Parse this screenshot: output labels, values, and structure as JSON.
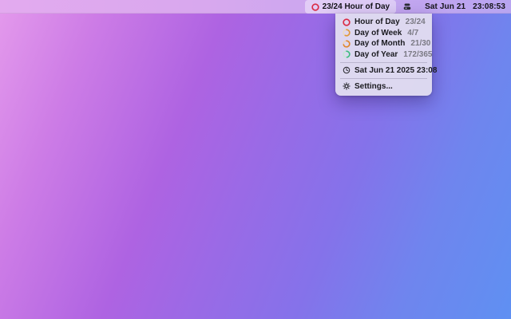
{
  "wallpaper": {
    "gradient_from": "#e49aec",
    "gradient_mid": "#9a6ae6",
    "gradient_to": "#5f90f2"
  },
  "menu_bar": {
    "active_item": {
      "label": "23/24 Hour of Day",
      "icon": "progress-ring-icon",
      "progress": 0.958,
      "color": "#d92b47",
      "track": "#eec9ce"
    },
    "extra_icon": "stacked-discs-icon",
    "clock_date": "Sat Jun 21",
    "clock_time": "23:08:53"
  },
  "dropdown": {
    "items": [
      {
        "label": "Hour of Day",
        "value": "23/24",
        "progress": 0.958,
        "color": "#d92b47",
        "track": "#eec9ce",
        "icon": "progress-ring-icon"
      },
      {
        "label": "Day of Week",
        "value": "4/7",
        "progress": 0.571,
        "color": "#e0983a",
        "track": "#ecdbc0",
        "icon": "progress-ring-icon"
      },
      {
        "label": "Day of Month",
        "value": "21/30",
        "progress": 0.7,
        "color": "#e0862f",
        "track": "#eed4ba",
        "icon": "progress-ring-icon"
      },
      {
        "label": "Day of Year",
        "value": "172/365",
        "progress": 0.471,
        "color": "#3cba80",
        "track": "#c8e5d6",
        "icon": "progress-ring-icon"
      }
    ],
    "datetime_row": {
      "label": "Sat Jun 21 2025 23:08",
      "icon": "clock-icon"
    },
    "settings_row": {
      "label": "Settings...",
      "icon": "gear-icon"
    }
  }
}
